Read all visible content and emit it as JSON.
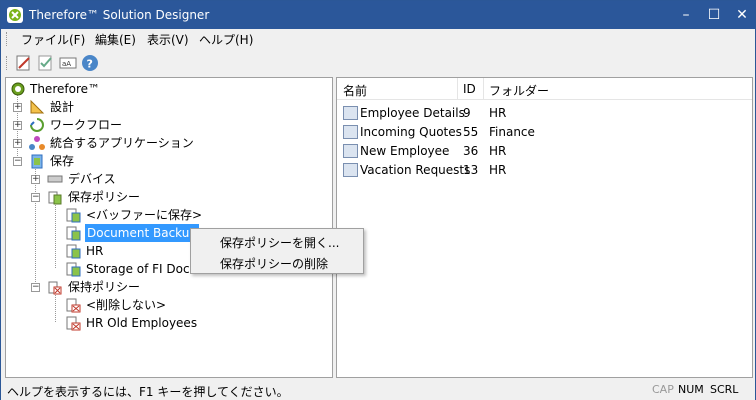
{
  "window": {
    "title": "Therefore™ Solution Designer"
  },
  "menu": [
    "ファイル(F)",
    "編集(E)",
    "表示(V)",
    "ヘルプ(H)"
  ],
  "toolbar": {
    "icons": [
      "designer-icon",
      "check-icon",
      "abc-icon",
      "help-icon"
    ]
  },
  "tree": {
    "root": "Therefore™",
    "items": {
      "design": "設計",
      "workflow": "ワークフロー",
      "integrated_apps": "統合するアプリケーション",
      "storage": "保存",
      "devices": "デバイス",
      "storage_policy": "保存ポリシー",
      "save_to_buffer": "<バッファーに保存>",
      "document_backup": "Document Backup",
      "hr": "HR",
      "storage_fi": "Storage of FI Docur",
      "retention_policy": "保持ポリシー",
      "no_delete": "<削除しない>",
      "hr_old": "HR Old Employees"
    }
  },
  "list": {
    "headers": {
      "name": "名前",
      "id": "ID",
      "folder": "フォルダー"
    },
    "rows": [
      {
        "name": "Employee Details",
        "id": "9",
        "folder": "HR"
      },
      {
        "name": "Incoming Quotes",
        "id": "55",
        "folder": "Finance"
      },
      {
        "name": "New Employee",
        "id": "36",
        "folder": "HR"
      },
      {
        "name": "Vacation Requests",
        "id": "13",
        "folder": "HR"
      }
    ]
  },
  "context_menu": {
    "open": "保存ポリシーを開く...",
    "delete": "保存ポリシーの削除"
  },
  "status": {
    "help": "ヘルプを表示するには、F1 キーを押してください。",
    "cap": "CAP",
    "num": "NUM",
    "scrl": "SCRL"
  },
  "colors": {
    "titlebar": "#2b579a",
    "selection": "#3399ff"
  }
}
